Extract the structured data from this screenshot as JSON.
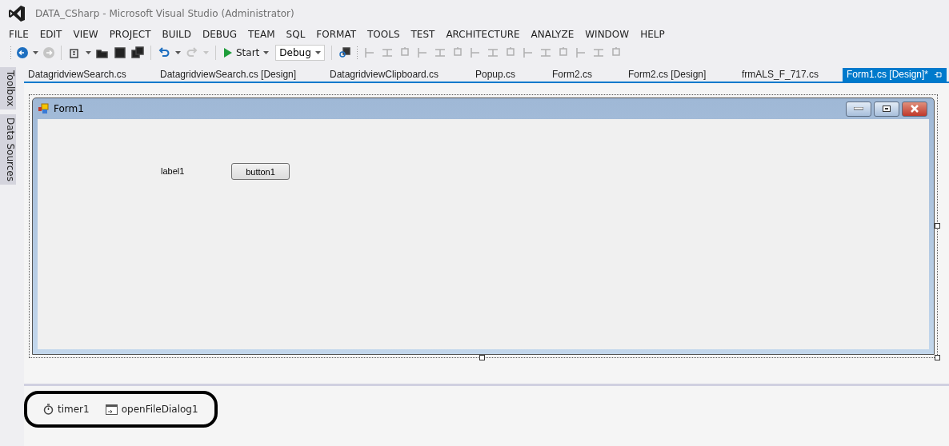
{
  "window": {
    "title": "DATA_CSharp - Microsoft Visual Studio (Administrator)"
  },
  "menu": [
    "FILE",
    "EDIT",
    "VIEW",
    "PROJECT",
    "BUILD",
    "DEBUG",
    "TEAM",
    "SQL",
    "FORMAT",
    "TOOLS",
    "TEST",
    "ARCHITECTURE",
    "ANALYZE",
    "WINDOW",
    "HELP"
  ],
  "toolbar": {
    "start": "Start",
    "configuration": "Debug"
  },
  "side_tabs": [
    "Toolbox",
    "Data Sources"
  ],
  "document_tabs": [
    {
      "label": "DatagridviewSearch.cs",
      "selected": false
    },
    {
      "label": "DatagridviewSearch.cs [Design]",
      "selected": false
    },
    {
      "label": "DatagridviewClipboard.cs",
      "selected": false
    },
    {
      "label": "Popup.cs",
      "selected": false
    },
    {
      "label": "Form2.cs",
      "selected": false
    },
    {
      "label": "Form2.cs [Design]",
      "selected": false
    },
    {
      "label": "frmALS_F_717.cs",
      "selected": false
    },
    {
      "label": "Form1.cs [Design]*",
      "selected": true
    }
  ],
  "form": {
    "title": "Form1",
    "label": "label1",
    "button": "button1"
  },
  "tray": [
    {
      "kind": "timer",
      "label": "timer1"
    },
    {
      "kind": "dialog",
      "label": "openFileDialog1"
    }
  ]
}
